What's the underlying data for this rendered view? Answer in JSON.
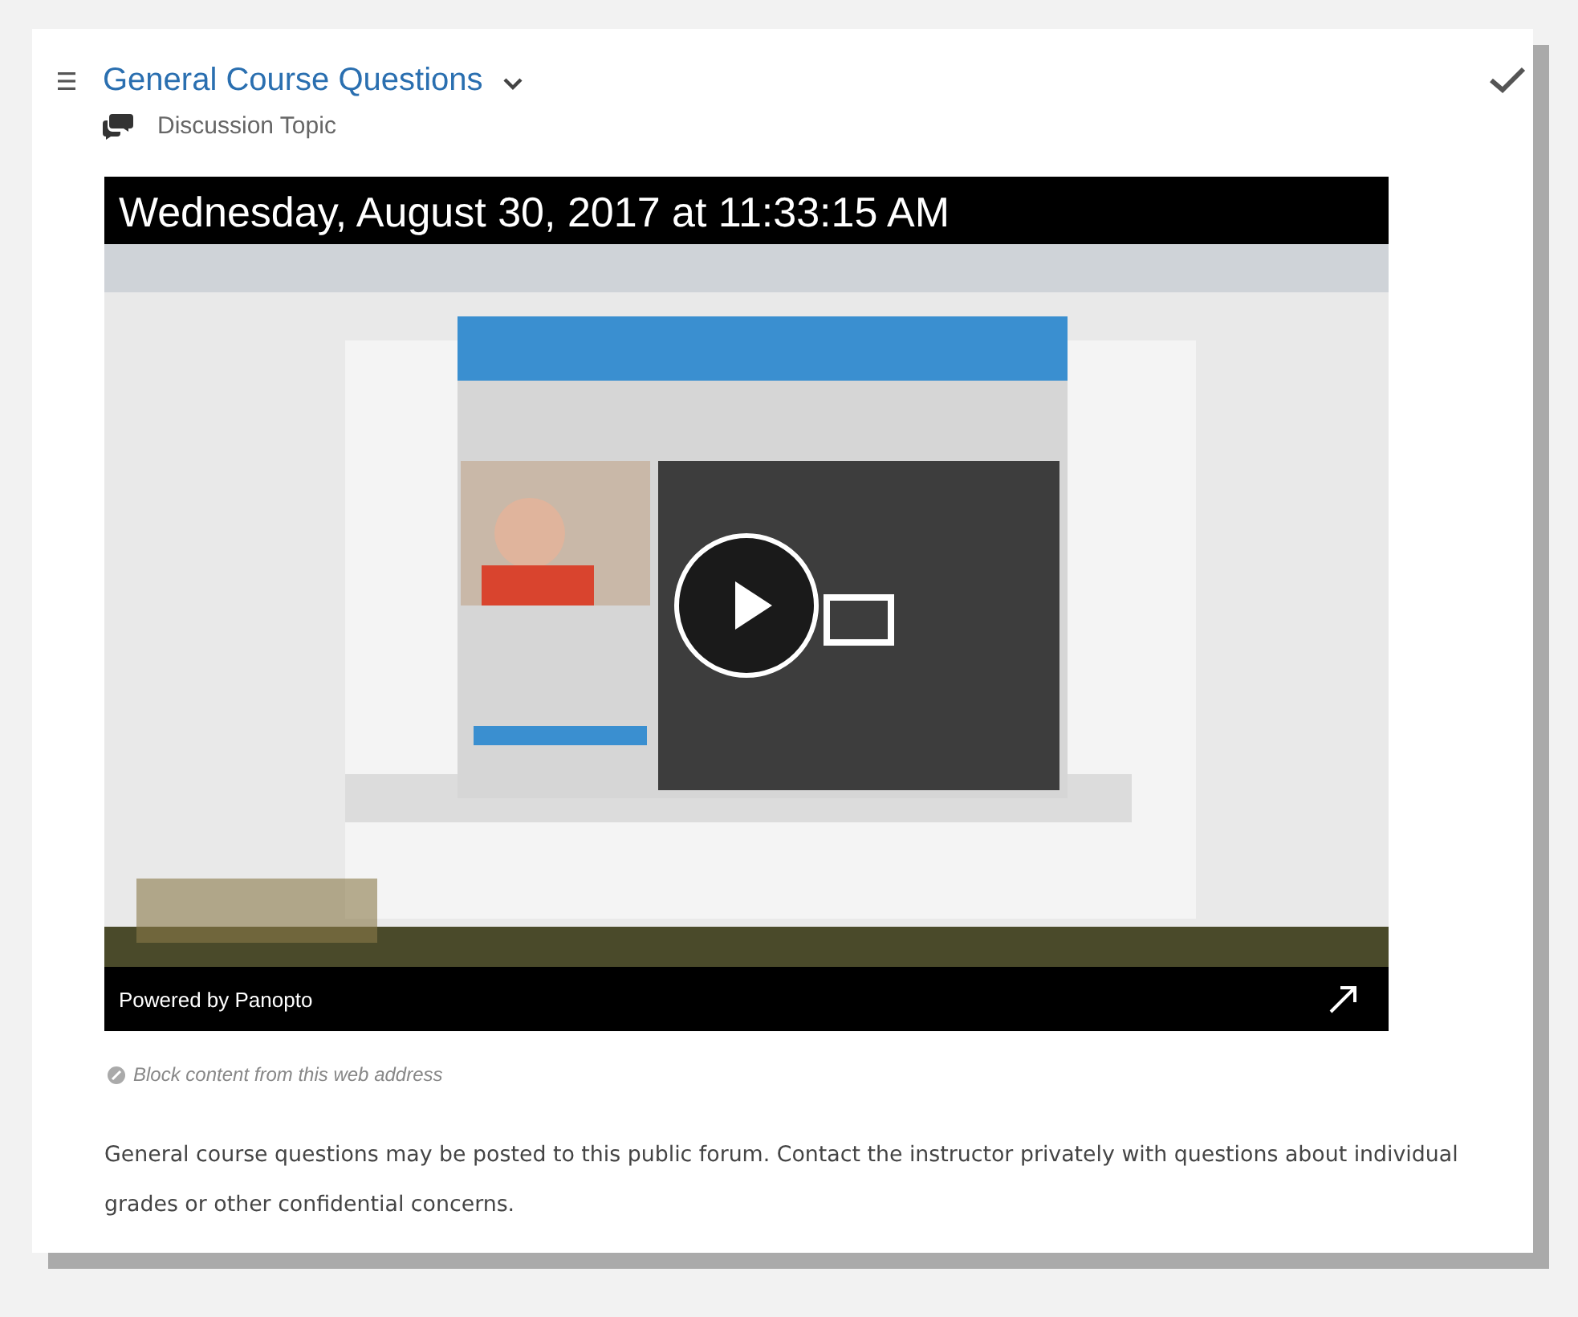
{
  "item": {
    "title": "General Course Questions",
    "type_label": "Discussion Topic",
    "completed": true
  },
  "video": {
    "timestamp": "Wednesday, August 30, 2017 at 11:33:15 AM",
    "branding": "Powered by Panopto"
  },
  "block_link": "Block content from this web address",
  "description": "General course questions may be posted to this public forum. Contact the instructor privately with questions about individual grades or other confidential concerns."
}
